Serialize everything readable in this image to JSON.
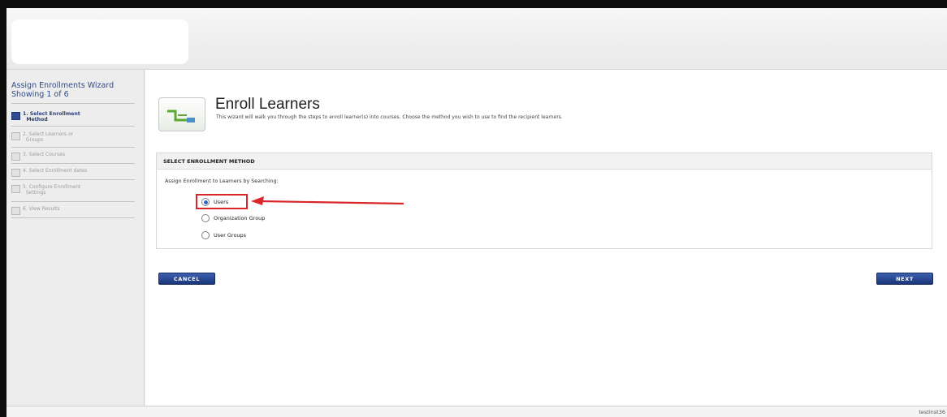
{
  "sidebar": {
    "title_line1": "Assign Enrollments Wizard",
    "title_line2": "Showing 1 of 6",
    "steps": [
      {
        "label_line1": "1. Select Enrollment",
        "label_line2": "Method",
        "active": true
      },
      {
        "label_line1": "2. Select Learners or",
        "label_line2": "Groups",
        "active": false
      },
      {
        "label_line1": "3. Select Courses",
        "label_line2": "",
        "active": false
      },
      {
        "label_line1": "4. Select Enrollment dates",
        "label_line2": "",
        "active": false
      },
      {
        "label_line1": "5. Configure Enrollment",
        "label_line2": "Settings",
        "active": false
      },
      {
        "label_line1": "6. View Results",
        "label_line2": "",
        "active": false
      }
    ]
  },
  "main": {
    "title": "Enroll Learners",
    "subtitle": "This wizard will walk you through the steps to enroll learner(s) into courses. Choose the method you wish to use to find the recipient learners.",
    "section_header": "SELECT ENROLLMENT METHOD",
    "assign_label": "Assign Enrollment to Learners by Searching:",
    "options": [
      {
        "label": "Users",
        "selected": true
      },
      {
        "label": "Organization Group",
        "selected": false
      },
      {
        "label": "User Groups",
        "selected": false
      }
    ],
    "cancel_label": "CANCEL",
    "next_label": "NEXT"
  },
  "footer": {
    "text": "testinst36"
  },
  "colors": {
    "accent": "#2e4c8f",
    "button": "#1f3a7d",
    "highlight": "#d9262a",
    "icon_green": "#5aa832"
  },
  "icons": {
    "header": "enroll-learners-icon",
    "step_checkbox": "step-checkbox-icon"
  }
}
